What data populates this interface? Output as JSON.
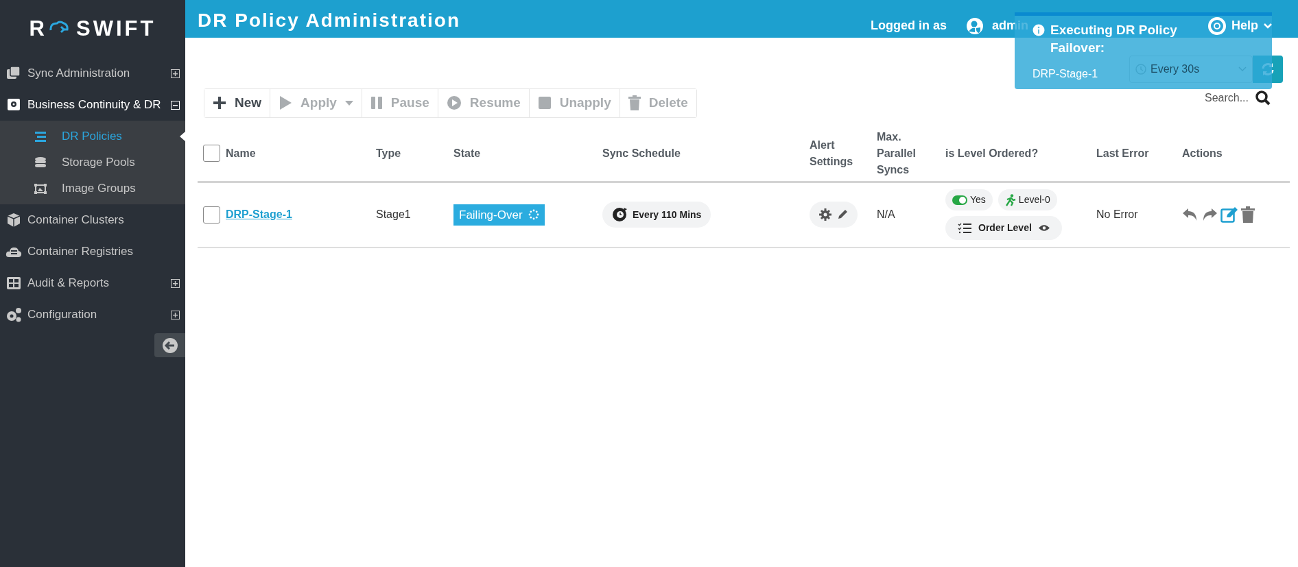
{
  "brand": {
    "letter": "R",
    "name": "SWIFT"
  },
  "sidebar": {
    "items": [
      {
        "label": "Sync Administration",
        "expanded": false
      },
      {
        "label": "Business Continuity & DR",
        "expanded": true,
        "children": [
          {
            "label": "DR Policies",
            "selected": true
          },
          {
            "label": "Storage Pools",
            "selected": false
          },
          {
            "label": "Image Groups",
            "selected": false
          }
        ]
      },
      {
        "label": "Container Clusters"
      },
      {
        "label": "Container Registries"
      },
      {
        "label": "Audit & Reports",
        "expanded": false
      },
      {
        "label": "Configuration",
        "expanded": false
      }
    ]
  },
  "header": {
    "title": "DR Policy Administration",
    "logged_in_label": "Logged in as",
    "user": "admin",
    "help": "Help"
  },
  "toast": {
    "title": "Executing DR Policy Failover:",
    "message": "DRP-Stage-1"
  },
  "refresh": {
    "interval": "Every 30s"
  },
  "toolbar": {
    "buttons": [
      {
        "label": "New",
        "disabled": false
      },
      {
        "label": "Apply",
        "disabled": true,
        "dropdown": true
      },
      {
        "label": "Pause",
        "disabled": true
      },
      {
        "label": "Resume",
        "disabled": true
      },
      {
        "label": "Unapply",
        "disabled": true
      },
      {
        "label": "Delete",
        "disabled": true
      }
    ]
  },
  "search": {
    "placeholder": "Search..."
  },
  "table": {
    "select_all": {
      "checked": false
    },
    "columns": [
      "Name",
      "Type",
      "State",
      "Sync Schedule",
      "Alert Settings",
      "Max. Parallel Syncs",
      "is Level Ordered?",
      "Last Error",
      "Actions"
    ],
    "rows": [
      {
        "checked": false,
        "name": "DRP-Stage-1",
        "type": "Stage1",
        "state": "Failing-Over",
        "schedule": "Every 110 Mins",
        "max_parallel": "N/A",
        "level_ordered": {
          "on": true,
          "label": "Yes",
          "level": "Level-0",
          "order_button": "Order Level"
        },
        "last_error": "No Error"
      }
    ]
  }
}
